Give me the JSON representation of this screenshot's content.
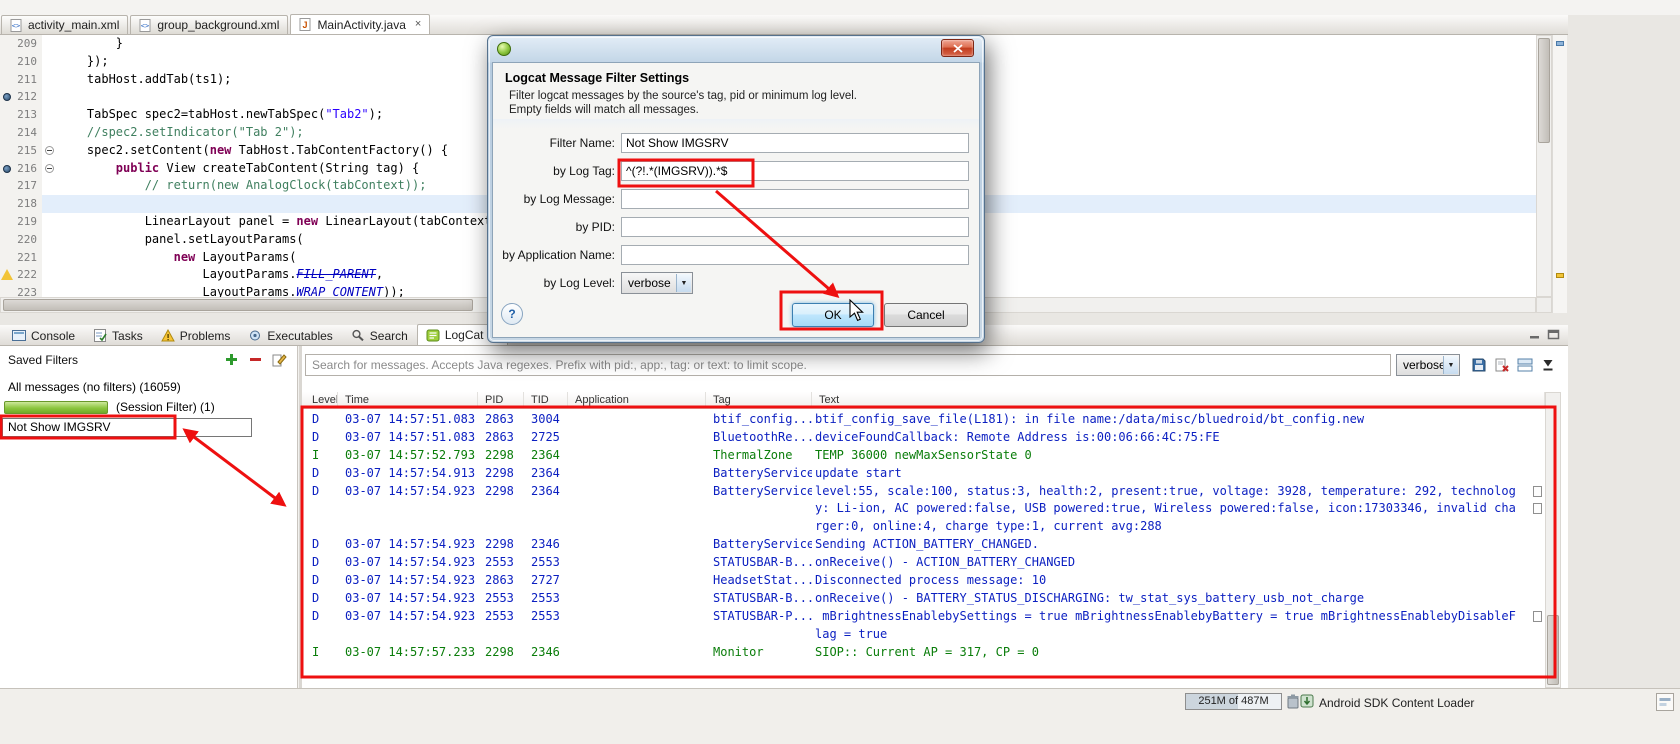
{
  "colors": {
    "annotation_red": "#ee1010",
    "debug_row": "#0b1fc1",
    "info_row": "#0a7d0a",
    "keyword": "#7f0055",
    "string": "#2a00ff",
    "comment": "#3f7f5f"
  },
  "editor": {
    "tabs": [
      {
        "label": "activity_main.xml",
        "icon": "xml-file-icon",
        "active": false
      },
      {
        "label": "group_background.xml",
        "icon": "xml-file-icon",
        "active": false
      },
      {
        "label": "MainActivity.java",
        "icon": "java-file-icon",
        "active": true
      }
    ],
    "close_glyph": "×",
    "lines": [
      {
        "num": "209",
        "segs": [
          {
            "t": "        }"
          }
        ]
      },
      {
        "num": "210",
        "segs": [
          {
            "t": "    });"
          }
        ]
      },
      {
        "num": "211",
        "segs": [
          {
            "t": "    tabHost.addTab(ts1);"
          }
        ]
      },
      {
        "num": "212",
        "segs": [],
        "marker": "breakpoint"
      },
      {
        "num": "213",
        "segs": [
          {
            "t": "    TabSpec spec2=tabHost.newTabSpec("
          },
          {
            "t": "\"Tab2\"",
            "c": "string"
          },
          {
            "t": ");"
          }
        ]
      },
      {
        "num": "214",
        "segs": [
          {
            "t": "    //spec2.setIndicator(\"Tab 2\");",
            "c": "comment"
          }
        ]
      },
      {
        "num": "215",
        "segs": [
          {
            "t": "    spec2.setContent("
          },
          {
            "t": "new",
            "c": "keyword"
          },
          {
            "t": " TabHost.TabContentFactory() {"
          }
        ],
        "fold": true
      },
      {
        "num": "216",
        "segs": [
          {
            "t": "        "
          },
          {
            "t": "public",
            "c": "keyword"
          },
          {
            "t": " View createTabContent(String tag) {"
          }
        ],
        "fold": true,
        "marker": "breakpoint"
      },
      {
        "num": "217",
        "segs": [
          {
            "t": "            // return(new AnalogClock(tabContext));",
            "c": "comment"
          }
        ]
      },
      {
        "num": "218",
        "segs": [],
        "highlight": true
      },
      {
        "num": "219",
        "segs": [
          {
            "t": "            LinearLayout panel = "
          },
          {
            "t": "new",
            "c": "keyword"
          },
          {
            "t": " LinearLayout(tabContext);"
          }
        ]
      },
      {
        "num": "220",
        "segs": [
          {
            "t": "            panel.setLayoutParams("
          }
        ]
      },
      {
        "num": "221",
        "segs": [
          {
            "t": "                "
          },
          {
            "t": "new",
            "c": "keyword"
          },
          {
            "t": " LayoutParams("
          }
        ]
      },
      {
        "num": "222",
        "segs": [
          {
            "t": "                    LayoutParams."
          },
          {
            "t": "FILL_PARENT",
            "c": "deprecated"
          },
          {
            "t": ","
          }
        ],
        "marker": "warning"
      },
      {
        "num": "223",
        "segs": [
          {
            "t": "                    LayoutParams."
          },
          {
            "t": "WRAP_CONTENT",
            "c": "static"
          },
          {
            "t": "));"
          }
        ]
      }
    ]
  },
  "dialog": {
    "heading": "Logcat Message Filter Settings",
    "description_line1": "Filter logcat messages by the source's tag, pid or minimum log level.",
    "description_line2": "Empty fields will match all messages.",
    "fields": {
      "filter_name": {
        "label": "Filter Name:",
        "value": "Not Show IMGSRV"
      },
      "log_tag": {
        "label": "by Log Tag:",
        "value": "^(?!.*(IMGSRV)).*$"
      },
      "log_message": {
        "label": "by Log Message:",
        "value": ""
      },
      "pid": {
        "label": "by PID:",
        "value": ""
      },
      "app_name": {
        "label": "by Application Name:",
        "value": ""
      },
      "log_level": {
        "label": "by Log Level:",
        "value": "verbose"
      }
    },
    "help_label": "?",
    "ok_label": "OK",
    "cancel_label": "Cancel"
  },
  "views": {
    "tabs": [
      {
        "label": "Console",
        "icon": "console-icon",
        "active": false
      },
      {
        "label": "Tasks",
        "icon": "tasks-icon",
        "active": false
      },
      {
        "label": "Problems",
        "icon": "problems-icon",
        "active": false
      },
      {
        "label": "Executables",
        "icon": "executables-icon",
        "active": false
      },
      {
        "label": "Search",
        "icon": "search-icon",
        "active": false
      },
      {
        "label": "LogCat",
        "icon": "logcat-icon",
        "active": true
      }
    ]
  },
  "saved_filters": {
    "title": "Saved Filters",
    "actions": [
      "add-filter-icon",
      "remove-filter-icon",
      "edit-filter-icon"
    ],
    "all_messages": "All messages (no filters) (16059)",
    "session_label": "(Session Filter) (1)",
    "selected_filter": "Not Show IMGSRV"
  },
  "logcat": {
    "search_placeholder": "Search for messages. Accepts Java regexes. Prefix with pid:, app:, tag: or text: to limit scope.",
    "level_filter": "verbose",
    "toolbar_icons": [
      "save-log-icon",
      "clear-log-icon",
      "display-panes-icon",
      "autoscroll-icon"
    ],
    "columns": [
      "Level",
      "Time",
      "PID",
      "TID",
      "Application",
      "Tag",
      "Text"
    ],
    "rows": [
      {
        "level": "D",
        "time": "03-07 14:57:51.083",
        "pid": "2863",
        "tid": "3004",
        "app": "",
        "tag": "btif_config...",
        "text": [
          "btif_config_save_file(L181): in file name:/data/misc/bluedroid/bt_config.new"
        ]
      },
      {
        "level": "D",
        "time": "03-07 14:57:51.083",
        "pid": "2863",
        "tid": "2725",
        "app": "",
        "tag": "BluetoothRe...",
        "text": [
          "deviceFoundCallback: Remote Address is:00:06:66:4C:75:FE"
        ]
      },
      {
        "level": "I",
        "time": "03-07 14:57:52.793",
        "pid": "2298",
        "tid": "2364",
        "app": "",
        "tag": "ThermalZone",
        "text": [
          "TEMP 36000 newMaxSensorState 0"
        ]
      },
      {
        "level": "D",
        "time": "03-07 14:57:54.913",
        "pid": "2298",
        "tid": "2364",
        "app": "",
        "tag": "BatteryService",
        "text": [
          "update start"
        ]
      },
      {
        "level": "D",
        "time": "03-07 14:57:54.923",
        "pid": "2298",
        "tid": "2364",
        "app": "",
        "tag": "BatteryService",
        "text": [
          "level:55, scale:100, status:3, health:2, present:true, voltage: 3928, temperature: 292, technolog",
          "y: Li-ion, AC powered:false, USB powered:true, Wireless powered:false, icon:17303346, invalid cha",
          "rger:0, online:4, charge type:1, current avg:288"
        ]
      },
      {
        "level": "D",
        "time": "03-07 14:57:54.923",
        "pid": "2298",
        "tid": "2346",
        "app": "",
        "tag": "BatteryService",
        "text": [
          "Sending ACTION_BATTERY_CHANGED."
        ]
      },
      {
        "level": "D",
        "time": "03-07 14:57:54.923",
        "pid": "2553",
        "tid": "2553",
        "app": "",
        "tag": "STATUSBAR-B...",
        "text": [
          "onReceive() - ACTION_BATTERY_CHANGED"
        ]
      },
      {
        "level": "D",
        "time": "03-07 14:57:54.923",
        "pid": "2863",
        "tid": "2727",
        "app": "",
        "tag": "HeadsetStat...",
        "text": [
          "Disconnected process message: 10"
        ]
      },
      {
        "level": "D",
        "time": "03-07 14:57:54.923",
        "pid": "2553",
        "tid": "2553",
        "app": "",
        "tag": "STATUSBAR-B...",
        "text": [
          "onReceive() - BATTERY_STATUS_DISCHARGING: tw_stat_sys_battery_usb_not_charge"
        ]
      },
      {
        "level": "D",
        "time": "03-07 14:57:54.923",
        "pid": "2553",
        "tid": "2553",
        "app": "",
        "tag": "STATUSBAR-P...",
        "text": [
          " mBrightnessEnablebySettings = true mBrightnessEnablebyBattery = true mBrightnessEnablebyDisableF",
          "lag = true"
        ]
      },
      {
        "level": "I",
        "time": "03-07 14:57:57.233",
        "pid": "2298",
        "tid": "2346",
        "app": "",
        "tag": "Monitor",
        "text": [
          "SIOP:: Current AP = 317, CP = 0"
        ]
      }
    ]
  },
  "status_bar": {
    "heap": "251M of 487M",
    "job": "Android SDK Content Loader"
  }
}
